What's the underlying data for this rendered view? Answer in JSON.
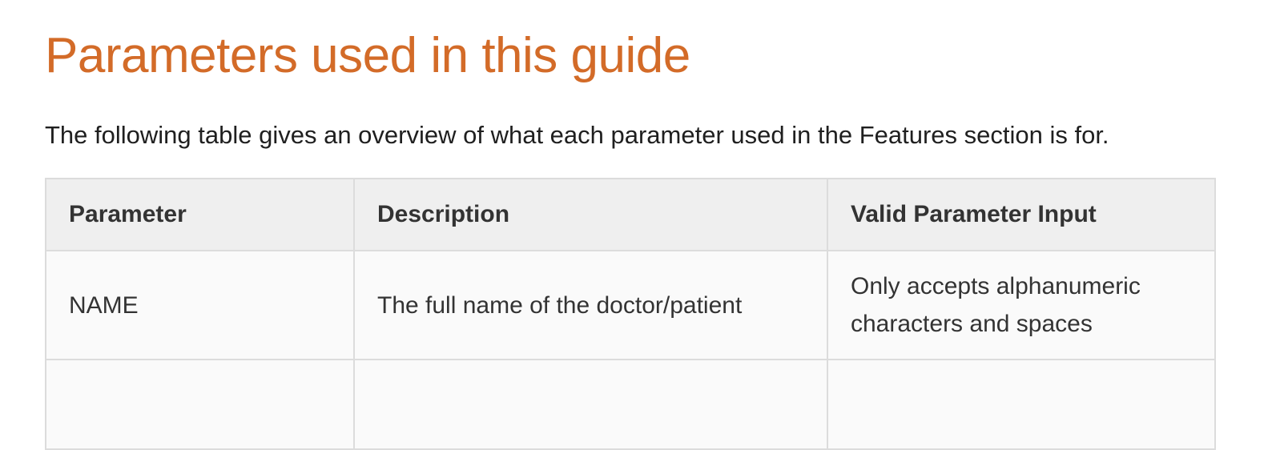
{
  "heading": "Parameters used in this guide",
  "intro": "The following table gives an overview of what each parameter used in the Features section is for.",
  "table": {
    "headers": [
      "Parameter",
      "Description",
      "Valid Parameter Input"
    ],
    "rows": [
      {
        "parameter": "NAME",
        "description": "The full name of the doctor/patient",
        "valid_input": "Only accepts alphanumeric characters and spaces"
      },
      {
        "parameter": "",
        "description": "",
        "valid_input": ""
      }
    ]
  },
  "colors": {
    "heading": "#d36b28",
    "header_bg": "#efefef",
    "border": "#dcdcdc"
  }
}
